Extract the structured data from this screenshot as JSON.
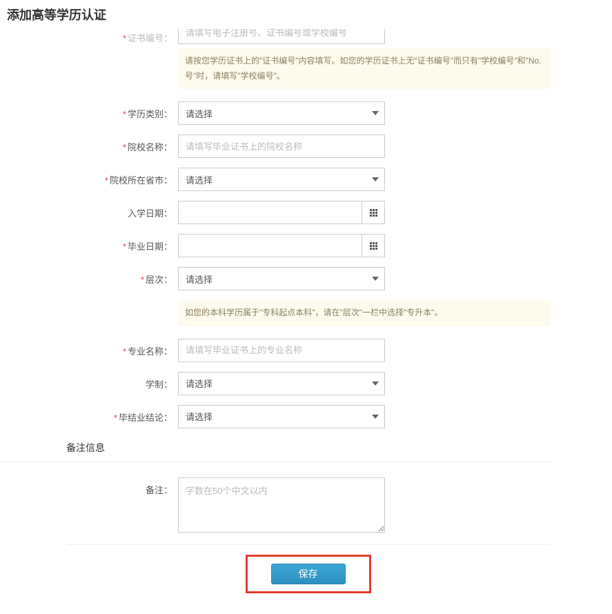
{
  "pageTitle": "添加高等学历认证",
  "fields": {
    "certNo": {
      "label": "证书编号：",
      "placeholder": "请填写电子注册号、证书编号或学校编号"
    },
    "certHint": "请按您学历证书上的\"证书编号\"内容填写。如您的学历证书上无\"证书编号\"而只有\"学校编号\"和\"No.号\"时，请填写\"学校编号\"。",
    "eduType": {
      "label": "学历类别：",
      "value": "请选择"
    },
    "schoolName": {
      "label": "院校名称：",
      "placeholder": "请填写毕业证书上的院校名称"
    },
    "schoolProvince": {
      "label": "院校所在省市：",
      "value": "请选择"
    },
    "enrollDate": {
      "label": "入学日期："
    },
    "gradDate": {
      "label": "毕业日期："
    },
    "level": {
      "label": "层次：",
      "value": "请选择"
    },
    "levelHint": "如您的本科学历属于\"专科起点本科\"，请在\"层次\"一栏中选择\"专升本\"。",
    "major": {
      "label": "专业名称：",
      "placeholder": "请填写毕业证书上的专业名称"
    },
    "schoolSystem": {
      "label": "学制：",
      "value": "请选择"
    },
    "gradConclusion": {
      "label": "毕结业结论：",
      "value": "请选择"
    },
    "remarkSection": "备注信息",
    "remark": {
      "label": "备注：",
      "placeholder": "字数在50个中文以内"
    }
  },
  "buttons": {
    "save": "保存"
  }
}
